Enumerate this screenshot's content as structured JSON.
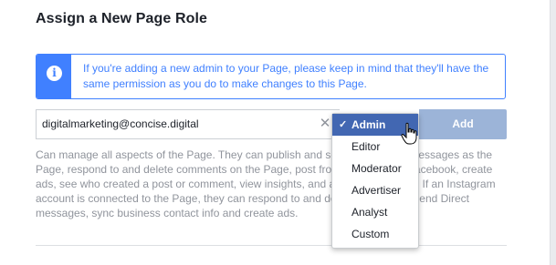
{
  "dialog": {
    "title": "Assign a New Page Role"
  },
  "info": {
    "icon": "info-icon",
    "icon_glyph": "i",
    "text": "If you're adding a new admin to your Page, please keep in mind that they'll have the same permission as you do to make changes to this Page.",
    "color": "#4080ff"
  },
  "assign": {
    "email_value": "digitalmarketing@concise.digital",
    "clear_glyph": "✕",
    "add_label": "Add"
  },
  "role_description": "Can manage all aspects of the Page. They can publish and send Messenger messages as the Page, respond to and delete comments on the Page, post from Instagram to Facebook, create ads, see who created a post or comment, view insights, and assign Page roles. If an Instagram account is connected to the Page, they can respond to and delete comments, send Direct messages, sync business contact info and create ads.",
  "role_dropdown": {
    "selected": "Admin",
    "check_glyph": "✓",
    "options": [
      "Admin",
      "Editor",
      "Moderator",
      "Advertiser",
      "Analyst",
      "Custom"
    ],
    "highlight_color": "#4267b2"
  }
}
